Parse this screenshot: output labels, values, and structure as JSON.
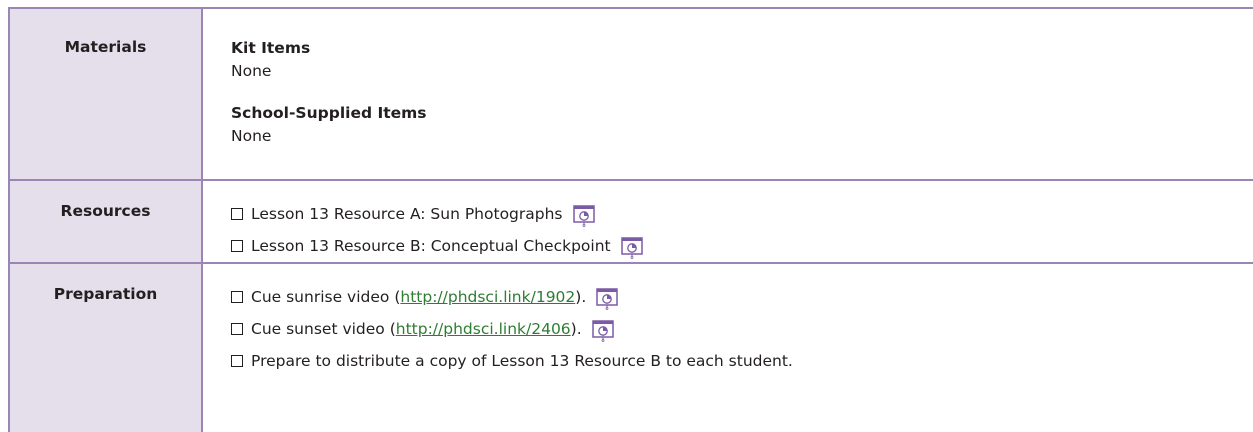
{
  "rows": {
    "materials": {
      "label": "Materials",
      "kit_items_heading": "Kit Items",
      "kit_items_value": "None",
      "school_items_heading": "School-Supplied Items",
      "school_items_value": "None"
    },
    "resources": {
      "label": "Resources",
      "items": [
        {
          "text": "Lesson 13 Resource A: Sun Photographs",
          "icon": "projector-icon"
        },
        {
          "text": "Lesson 13 Resource B: Conceptual Checkpoint",
          "icon": "projector-icon"
        }
      ]
    },
    "preparation": {
      "label": "Preparation",
      "items": [
        {
          "prefix": "Cue sunrise video (",
          "link": "http://phdsci.link/1902",
          "suffix": ").",
          "icon": "projector-icon"
        },
        {
          "prefix": "Cue sunset video (",
          "link": "http://phdsci.link/2406",
          "suffix": ").",
          "icon": "projector-icon"
        },
        {
          "text": "Prepare to distribute a copy of Lesson 13 Resource B to each student."
        }
      ]
    }
  },
  "colors": {
    "border": "#9b85b5",
    "label_background": "#e5dfec",
    "link": "#2e7d32",
    "icon_accent": "#7b5aa6"
  }
}
